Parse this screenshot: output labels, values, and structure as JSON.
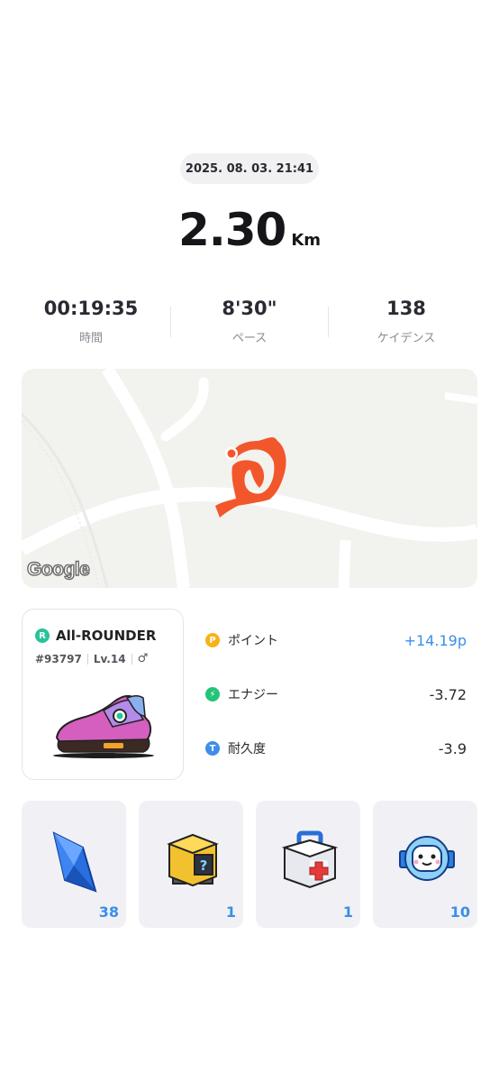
{
  "run": {
    "datetime": "2025. 08. 03. 21:41",
    "distance": "2.30",
    "distance_unit": "Km"
  },
  "stats": [
    {
      "value": "00:19:35",
      "label": "時間"
    },
    {
      "value": "8'30\"",
      "label": "ペース"
    },
    {
      "value": "138",
      "label": "ケイデンス"
    }
  ],
  "map": {
    "attribution": "Google",
    "route_color": "#f2572b"
  },
  "sneaker": {
    "class_icon": "R",
    "class_name": "All-ROUNDER",
    "token_id": "#93797",
    "level": "Lv.14",
    "gender_symbol": "♂",
    "image": "sneaker-icon"
  },
  "metrics": [
    {
      "icon": "P",
      "icon_color": "#f5b31a",
      "label": "ポイント",
      "value": "+14.19p",
      "positive": true
    },
    {
      "icon": "⚡",
      "icon_color": "#22c47a",
      "label": "エナジー",
      "value": "-3.72",
      "positive": false
    },
    {
      "icon": "T",
      "icon_color": "#3f8ee8",
      "label": "耐久度",
      "value": "-3.9",
      "positive": false
    }
  ],
  "items": [
    {
      "name": "blue-gem-icon",
      "qty": "38"
    },
    {
      "name": "mystery-box-icon",
      "qty": "1"
    },
    {
      "name": "first-aid-kit-icon",
      "qty": "1"
    },
    {
      "name": "robot-pet-icon",
      "qty": "10"
    }
  ],
  "colors": {
    "accent_blue": "#3a8fe8",
    "route_orange": "#f2572b",
    "class_green": "#27c39a"
  }
}
